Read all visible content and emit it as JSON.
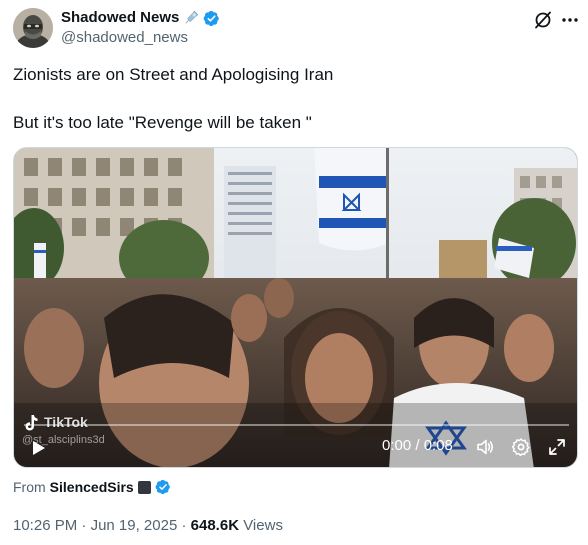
{
  "author": {
    "display_name": "Shadowed News",
    "handle": "@shadowed_news",
    "name_emoji": "syringe-icon",
    "verified": true,
    "verified_color": "#1d9bf0"
  },
  "tweet": {
    "line1": "Zionists are on Street and Apologising Iran",
    "line2": "But it's too late \"Revenge will be taken \""
  },
  "video": {
    "watermark_label": "TikTok",
    "watermark_user": "@st_alsciplins3d",
    "time": "0:00 / 0:08",
    "progress": 0
  },
  "source": {
    "prefix": "From",
    "name": "SilencedSirs",
    "verified": true
  },
  "meta": {
    "time": "10:26 PM",
    "date": "Jun 19, 2025",
    "views": "648.6K",
    "views_label": "Views",
    "separator": "·"
  }
}
